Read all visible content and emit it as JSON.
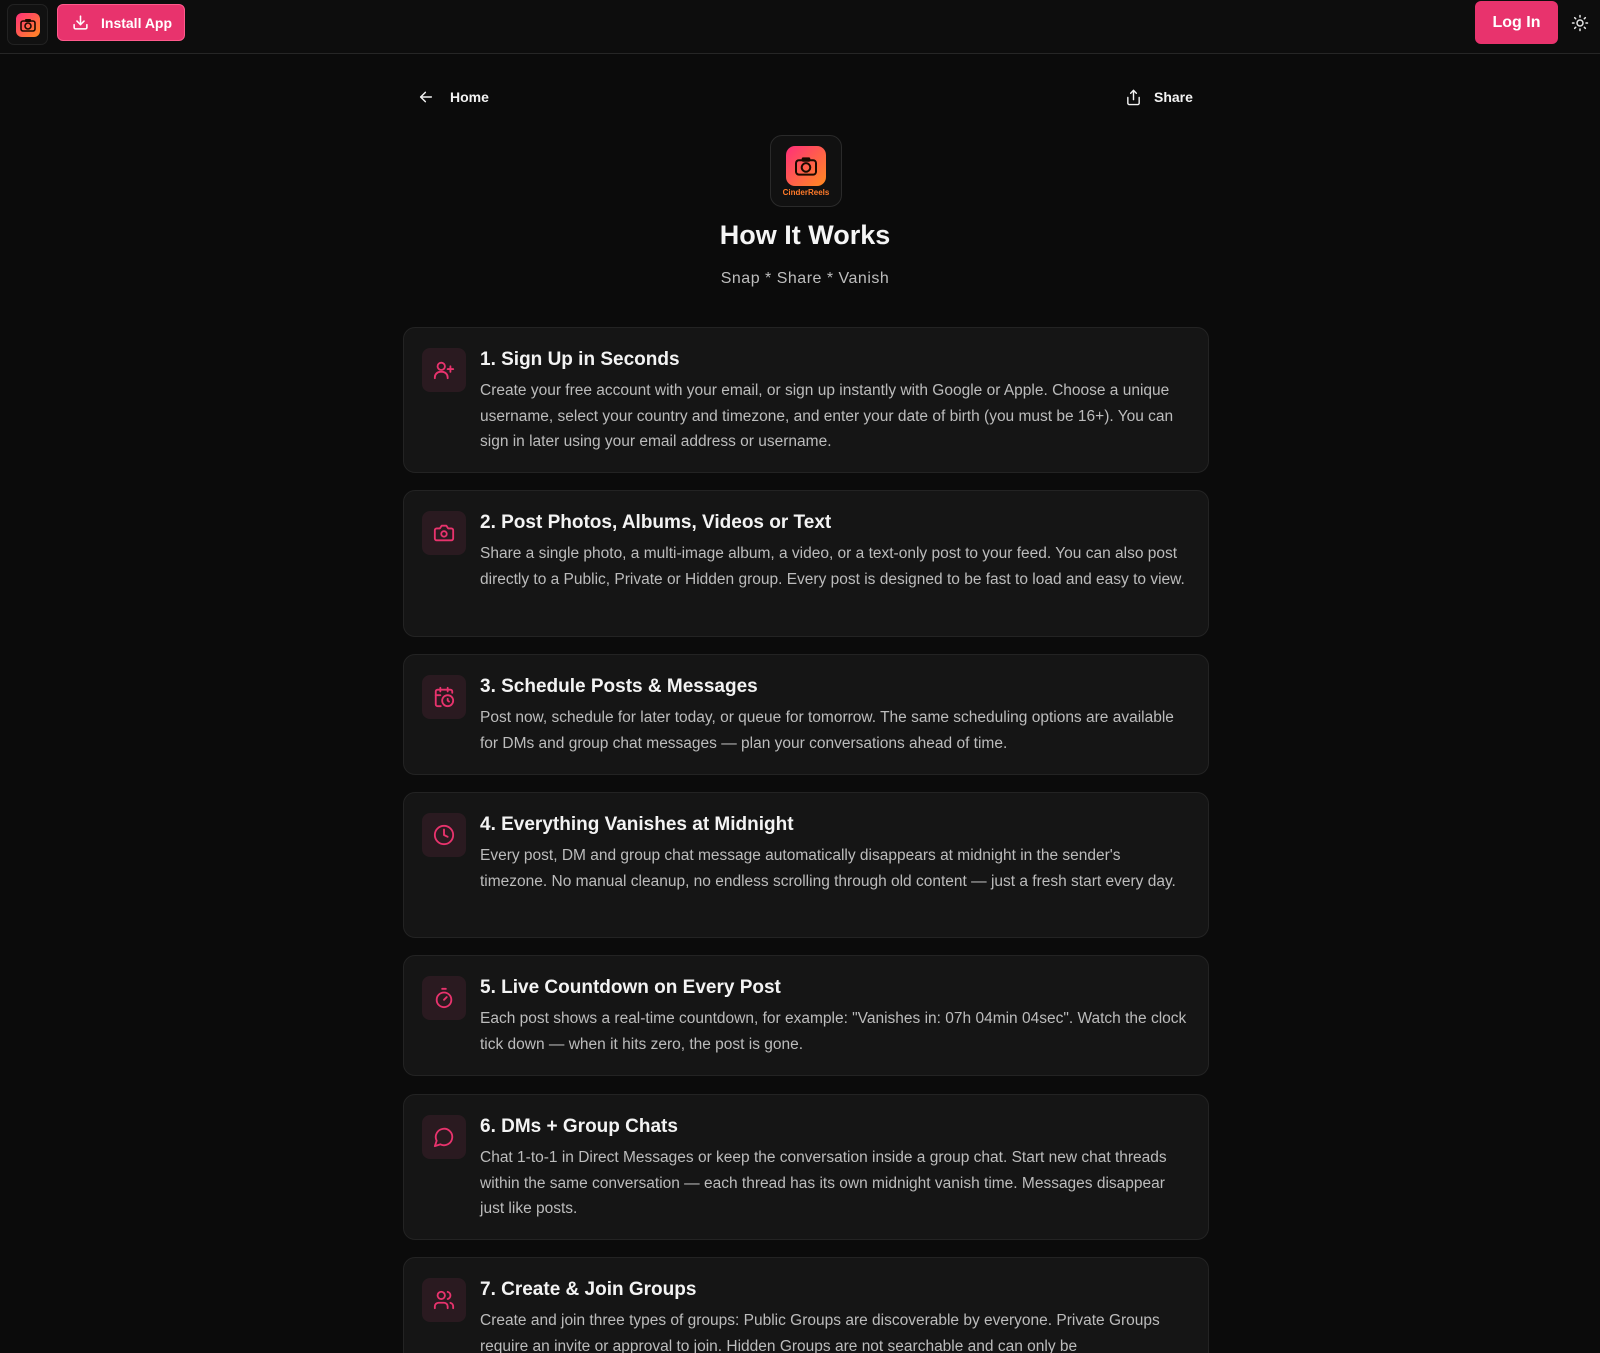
{
  "topbar": {
    "install_label": "Install App",
    "login_label": "Log In"
  },
  "nav": {
    "home_label": "Home",
    "share_label": "Share"
  },
  "hero": {
    "logo_text": "CinderReels",
    "title": "How It Works",
    "tagline": "Snap * Share * Vanish"
  },
  "accent_color": "#e8336d",
  "steps": [
    {
      "icon": "user-plus-icon",
      "title": "1. Sign Up in Seconds",
      "desc": "Create your free account with your email, or sign up instantly with Google or Apple. Choose a unique username, select your country and timezone, and enter your date of birth (you must be 16+). You can sign in later using your email address or username."
    },
    {
      "icon": "camera-icon",
      "title": "2. Post Photos, Albums, Videos or Text",
      "desc": "Share a single photo, a multi-image album, a video, or a text-only post to your feed. You can also post directly to a Public, Private or Hidden group. Every post is designed to be fast to load and easy to view."
    },
    {
      "icon": "calendar-clock-icon",
      "title": "3. Schedule Posts & Messages",
      "desc": "Post now, schedule for later today, or queue for tomorrow. The same scheduling options are available for DMs and group chat messages — plan your conversations ahead of time."
    },
    {
      "icon": "clock-icon",
      "title": "4. Everything Vanishes at Midnight",
      "desc": "Every post, DM and group chat message automatically disappears at midnight in the sender's timezone. No manual cleanup, no endless scrolling through old content — just a fresh start every day."
    },
    {
      "icon": "timer-icon",
      "title": "5. Live Countdown on Every Post",
      "desc": "Each post shows a real-time countdown, for example: \"Vanishes in: 07h 04min 04sec\". Watch the clock tick down — when it hits zero, the post is gone."
    },
    {
      "icon": "message-circle-icon",
      "title": "6. DMs + Group Chats",
      "desc": "Chat 1-to-1 in Direct Messages or keep the conversation inside a group chat. Start new chat threads within the same conversation — each thread has its own midnight vanish time. Messages disappear just like posts."
    },
    {
      "icon": "users-icon",
      "title": "7. Create & Join Groups",
      "desc": "Create and join three types of groups: Public Groups are discoverable by everyone. Private Groups require an invite or approval to join. Hidden Groups are not searchable and can only be"
    }
  ]
}
